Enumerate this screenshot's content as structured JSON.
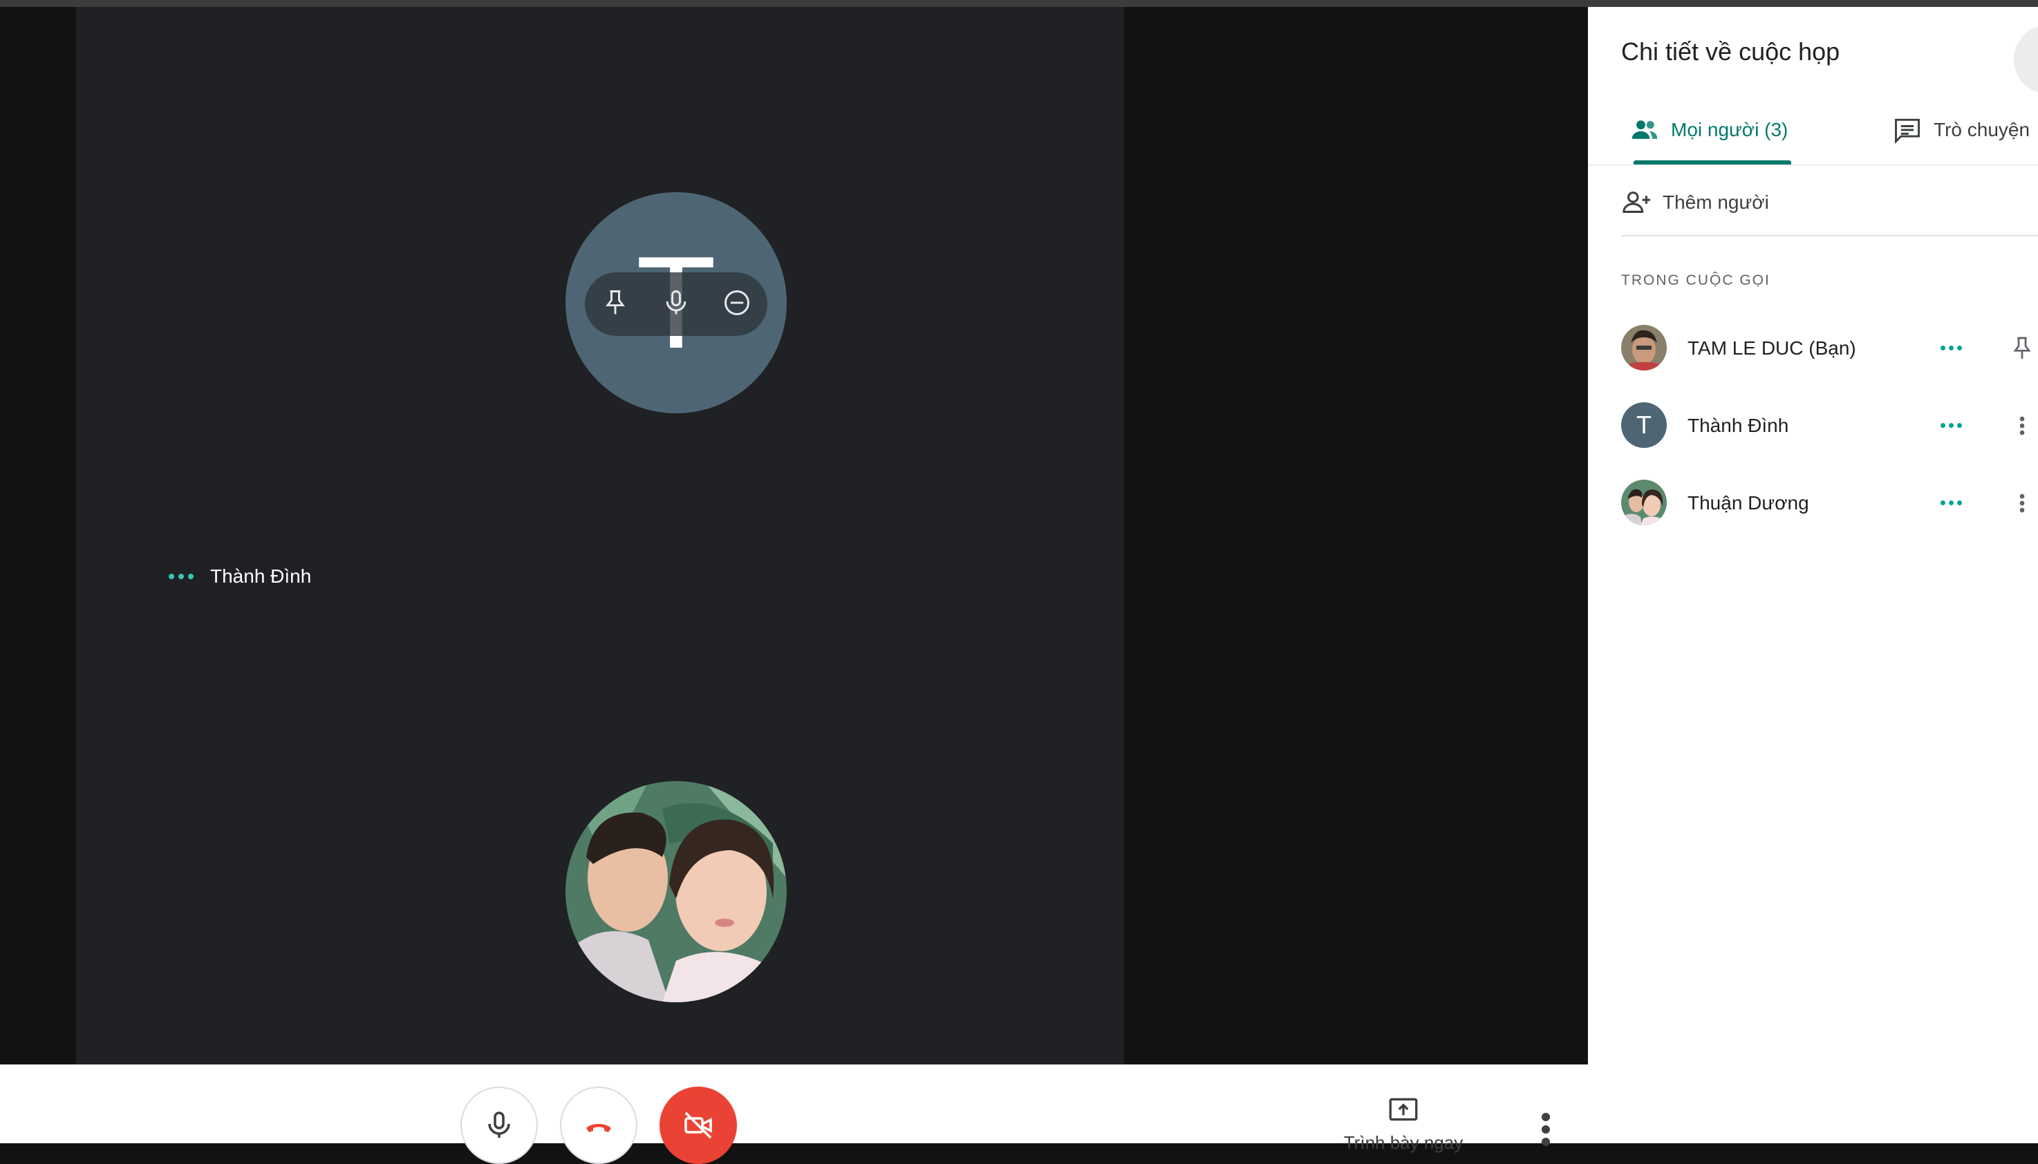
{
  "stage": {
    "main_avatar_initial": "T",
    "tile_name": "Thành Đình"
  },
  "controls": {
    "present_label": "Trình bày ngay"
  },
  "panel": {
    "title": "Chi tiết về cuộc họp",
    "tabs": [
      {
        "label": "Mọi người (3)",
        "active": true
      },
      {
        "label": "Trò chuyện",
        "active": false
      }
    ],
    "add_people_label": "Thêm người",
    "section_label": "TRONG CUỘC GỌI",
    "participants": [
      {
        "name": "TAM LE DUC (Bạn)",
        "action_icon": "pin-icon"
      },
      {
        "name": "Thành Đình",
        "initial": "T",
        "action_icon": "more-vert-icon"
      },
      {
        "name": "Thuận Dương",
        "action_icon": "more-vert-icon"
      }
    ]
  },
  "colors": {
    "accent": "#00796b",
    "speaking_dots": "#34c7b4",
    "end_call": "#ea4335",
    "avatar_bg": "#4e6674"
  }
}
